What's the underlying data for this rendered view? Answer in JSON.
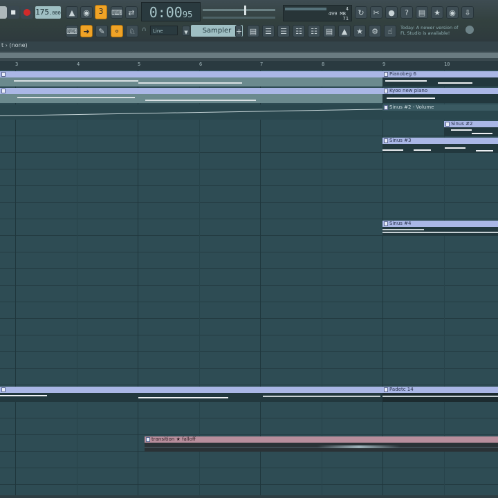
{
  "toolbar": {
    "tempo_value": "175",
    "tempo_decimal": ".000",
    "time_main": "0:00",
    "time_sub": "95",
    "cpu_top": "4",
    "cpu_ram": "499 MB",
    "cpu_poly": "71",
    "snap_label": "Line",
    "pattern_label": "Sampler",
    "hint_line1": "Today: A newer version of",
    "hint_line2": "FL Studio is available!"
  },
  "playlist": {
    "title": "t › (none)",
    "ruler": [
      "3",
      "4",
      "5",
      "6",
      "7",
      "8",
      "9",
      "10"
    ],
    "clips": [
      {
        "label": "Pianobeg 6"
      },
      {
        "label": "Kyoo new piano"
      },
      {
        "label": "Sinus #2 - Volume"
      },
      {
        "label": "Sinus #2"
      },
      {
        "label": "Sinus #3"
      },
      {
        "label": "Sinus #4"
      },
      {
        "label": "Padetc 14"
      },
      {
        "label": "transition ★ falloff"
      }
    ]
  },
  "colors": {
    "accent": "#f0a326",
    "grid_bg": "#2e4c54",
    "pattern_clip": "#aab7e6",
    "audio_clip": "#b88e9c",
    "record": "#d22a2a"
  },
  "icons": [
    "play-icon",
    "stop-icon",
    "record-icon",
    "metronome-icon",
    "countdown-icon",
    "typing-keyboard-icon",
    "pattern-song-icon",
    "save-icon",
    "undo-icon",
    "cut-icon",
    "microphone-icon",
    "help-icon",
    "settings-icon",
    "mixer-icon",
    "channel-rack-icon",
    "piano-roll-icon",
    "browser-icon",
    "plugin-icon",
    "download-icon"
  ]
}
